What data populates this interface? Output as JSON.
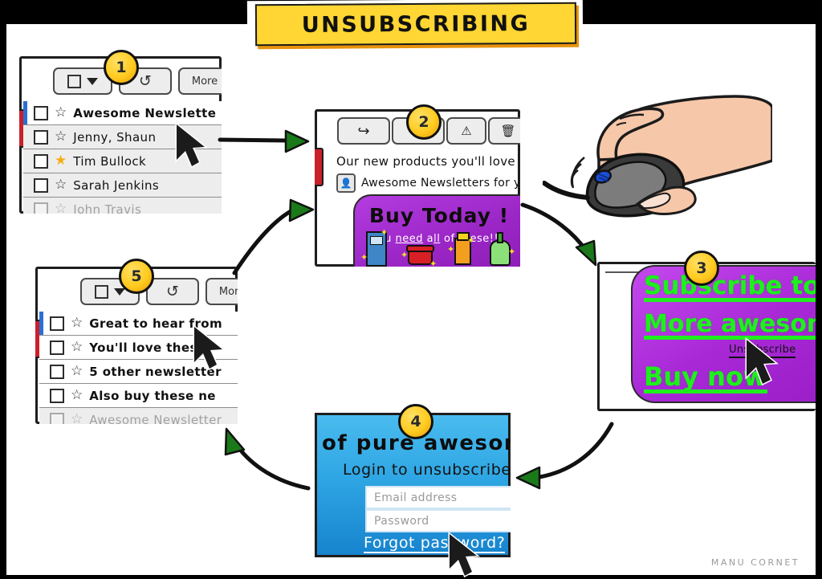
{
  "comic": {
    "title": "UNSUBSCRIBING",
    "signature": "MANU  CORNET",
    "colors": {
      "banner_bg": "#FFD633",
      "banner_shadow": "#E8920C",
      "arrow_head": "#1a7a1a",
      "promo_purple": "#A828D6",
      "login_blue": "#2FA6E4",
      "green_link": "#1EF01E",
      "red_tab": "#C9202B",
      "star_gold": "#F2AF14",
      "selected_blue": "#2B6FD4"
    }
  },
  "panels": [
    {
      "number": "1",
      "name": "inbox-before",
      "toolbar": {
        "select_all_icon": "checkbox-dropdown-icon",
        "refresh_icon": "refresh-icon",
        "more_label": "More"
      },
      "rows": [
        {
          "subject": "Awesome Newslette",
          "starred": false,
          "selected": true,
          "bold": true,
          "faded": false
        },
        {
          "subject": "Jenny, Shaun",
          "starred": false,
          "selected": false,
          "bold": false,
          "faded": false
        },
        {
          "subject": "Tim Bullock",
          "starred": true,
          "selected": false,
          "bold": false,
          "faded": false
        },
        {
          "subject": "Sarah Jenkins",
          "starred": false,
          "selected": false,
          "bold": false,
          "faded": false
        },
        {
          "subject": "John Travis",
          "starred": false,
          "selected": false,
          "bold": false,
          "faded": true
        }
      ]
    },
    {
      "number": "2",
      "name": "email-view",
      "toolbar_icons": [
        "reply-icon",
        "archive-icon",
        "spam-icon",
        "trash-icon"
      ],
      "subject": "Our new products you'll love",
      "sender": "Awesome  Newsletters  for yo",
      "promo_headline": "Buy Today !",
      "promo_sub_parts": [
        "You ",
        "need",
        " all",
        " of these!!"
      ],
      "products": [
        "blue-box-product",
        "red-pot-product",
        "orange-bottle-product",
        "green-spray-product"
      ]
    },
    {
      "number": "3",
      "name": "subscribe-page",
      "links": [
        "Subscribe to",
        "More awesom",
        "Buy now"
      ],
      "unsubscribe_label": "Unsubscribe"
    },
    {
      "number": "4",
      "name": "login-page",
      "title": "of  pure  awesome",
      "subtitle": "Login to unsubscribe",
      "email_placeholder": "Email address",
      "password_placeholder": "Password",
      "forgot_label": "Forgot  password?"
    },
    {
      "number": "5",
      "name": "inbox-after",
      "toolbar": {
        "select_all_icon": "checkbox-dropdown-icon",
        "refresh_icon": "refresh-icon",
        "more_label": "More"
      },
      "rows": [
        {
          "subject": "Great to hear from",
          "starred": false,
          "selected": true,
          "bold": true,
          "faded": false
        },
        {
          "subject": "You'll love these",
          "starred": false,
          "selected": false,
          "bold": true,
          "faded": false
        },
        {
          "subject": "5 other newsletter",
          "starred": false,
          "selected": false,
          "bold": true,
          "faded": false
        },
        {
          "subject": "Also buy these ne",
          "starred": false,
          "selected": false,
          "bold": true,
          "faded": false
        },
        {
          "subject": "Awesome  Newsletter",
          "starred": false,
          "selected": false,
          "bold": false,
          "faded": true
        }
      ]
    }
  ],
  "hand": {
    "label": "hand-holding-mouse",
    "skin": "#F6C7A9",
    "mouse_dark": "#3A3A3A",
    "mouse_light": "#7C7C7C",
    "scroll_wheel": "#1B4FD6"
  }
}
